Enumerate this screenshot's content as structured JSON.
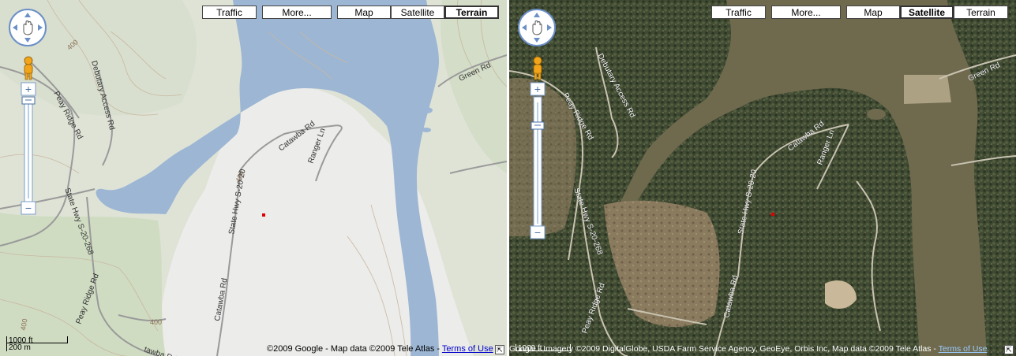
{
  "buttons": {
    "traffic": "Traffic",
    "more": "More...",
    "map": "Map",
    "satellite": "Satellite",
    "terrain": "Terrain"
  },
  "left": {
    "active_type": "Terrain",
    "roads": {
      "debutary": "Debutary Access Rd",
      "peasy_ridge_top": "Peay Ridge Rd",
      "state_hwy_268": "State Hwy S-20-268",
      "catawba_top": "Catawba Rd",
      "ranger": "Ranger Ln",
      "state_hwy_20": "State Hwy S-20-20",
      "catawba_bottom": "Catawba Rd",
      "peay_ridge_bottom": "Peay Ridge Rd",
      "green": "Green Rd",
      "catawba_cut": "tawba Rd"
    },
    "contours": {
      "c1": "400",
      "c2": "400",
      "c3": "400",
      "c4": "400"
    },
    "scale": {
      "top": "1000 ft",
      "bottom": "200 m"
    },
    "copyright": "©2009 Google - Map data ©2009 Tele Atlas - ",
    "terms": "Terms of Use"
  },
  "right": {
    "active_type": "Satellite",
    "roads": {
      "debutary": "Debutary Access Rd",
      "peay_ridge_top": "Peay Ridge Rd",
      "state_hwy_268": "State Hwy S-20-268",
      "catawba_top": "Catawba Rd",
      "ranger": "Ranger Ln",
      "state_hwy_20": "State Hwy S-20-20",
      "catawba_bottom": "Catawba Rd",
      "peay_ridge_bottom": "Peay Ridge Rd",
      "green": "Green Rd"
    },
    "scale": {
      "top": "1000 ft"
    },
    "copyright": "Google - Imagery ©2009 DigitalGlobe, USDA Farm Service Agency, GeoEye, Orbis Inc, Map data ©2009 Tele Atlas - ",
    "terms": "Terms of Use"
  },
  "colors": {
    "water_terrain": "#9cb6d4",
    "water_satellite": "#6f6a4e",
    "land_terrain": "#dfe3d9",
    "forest_satellite": "#3d4630",
    "marker": "#e00000"
  },
  "icons": {
    "pan": "pan-hand-icon",
    "pegman": "pegman-icon",
    "zoom_in": "zoom-in-icon",
    "zoom_out": "zoom-out-icon",
    "corner": "corner-arrow-icon"
  }
}
